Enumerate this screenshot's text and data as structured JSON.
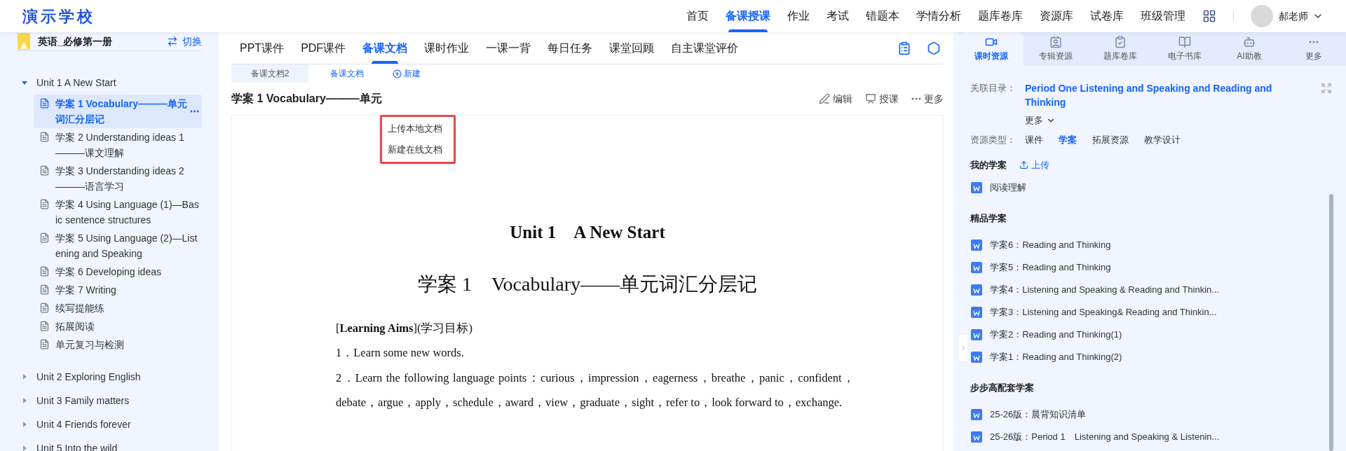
{
  "header": {
    "logo": "演示学校",
    "nav": [
      {
        "label": "首页",
        "selected": false
      },
      {
        "label": "备课授课",
        "selected": true
      },
      {
        "label": "作业",
        "selected": false
      },
      {
        "label": "考试",
        "selected": false
      },
      {
        "label": "错题本",
        "selected": false
      },
      {
        "label": "学情分析",
        "selected": false
      },
      {
        "label": "题库卷库",
        "selected": false
      },
      {
        "label": "资源库",
        "selected": false
      },
      {
        "label": "试卷库",
        "selected": false
      },
      {
        "label": "班级管理",
        "selected": false
      }
    ],
    "user": "郝老师"
  },
  "sidebar": {
    "book": "英语_必修第一册",
    "switch": "切换",
    "units": [
      {
        "label": "Unit 1 A New Start",
        "expanded": true,
        "children": [
          {
            "label": "学案 1 Vocabulary———单元词汇分层记",
            "selected": true
          },
          {
            "label": "学案 2 Understanding ideas 1 ———课文理解",
            "selected": false
          },
          {
            "label": "学案 3 Understanding ideas 2 ———语言学习",
            "selected": false
          },
          {
            "label": "学案 4 Using Language (1)—Basic sentence structures",
            "selected": false
          },
          {
            "label": "学案 5 Using Language (2)—Listening and Speaking",
            "selected": false
          },
          {
            "label": "学案 6 Developing ideas",
            "selected": false
          },
          {
            "label": "学案 7 Writing",
            "selected": false
          },
          {
            "label": "续写提能练",
            "selected": false
          },
          {
            "label": "拓展阅读",
            "selected": false
          },
          {
            "label": "单元复习与检测",
            "selected": false
          }
        ]
      },
      {
        "label": "Unit 2 Exploring English",
        "expanded": false
      },
      {
        "label": "Unit 3 Family matters",
        "expanded": false
      },
      {
        "label": "Unit 4 Friends forever",
        "expanded": false
      },
      {
        "label": "Unit 5 Into the wild",
        "expanded": false
      }
    ]
  },
  "main": {
    "tabs": [
      {
        "label": "PPT课件",
        "selected": false
      },
      {
        "label": "PDF课件",
        "selected": false
      },
      {
        "label": "备课文档",
        "selected": true
      },
      {
        "label": "课时作业",
        "selected": false
      },
      {
        "label": "一课一背",
        "selected": false
      },
      {
        "label": "每日任务",
        "selected": false
      },
      {
        "label": "课堂回顾",
        "selected": false
      },
      {
        "label": "自主课堂评价",
        "selected": false
      }
    ],
    "doc_tabs": [
      {
        "label": "备课文档2",
        "selected": false
      },
      {
        "label": "备课文档",
        "selected": true
      }
    ],
    "new": "新建",
    "menu": [
      "上传本地文档",
      "新建在线文档"
    ],
    "title": "学案 1 Vocabulary———单元",
    "actions": [
      "编辑",
      "授课",
      "更多"
    ],
    "document": {
      "heading": "Unit 1　A New Start",
      "subheading": "学案 1　Vocabulary——单元词汇分层记",
      "paragraphs": [
        "[**Learning Aims**](学习目标)",
        "1．Learn some new words.",
        "2．Learn the following language points：curious，impression，eagerness，breathe，panic，confident，debate，argue，apply，schedule，award，view，graduate，sight，refer to，look forward to，exchange."
      ]
    }
  },
  "panel": {
    "tabs": [
      {
        "label": "课时资源",
        "selected": true
      },
      {
        "label": "专辑资源",
        "selected": false
      },
      {
        "label": "题库卷库",
        "selected": false
      },
      {
        "label": "电子书库",
        "selected": false
      },
      {
        "label": "AI助教",
        "selected": false
      },
      {
        "label": "更多",
        "selected": false
      }
    ],
    "catalog_label": "关联目录：",
    "catalog": "Period One Listening and Speaking and Reading and Thinking",
    "more": "更多",
    "type_label": "资源类型：",
    "types": [
      {
        "label": "课件",
        "selected": false
      },
      {
        "label": "学案",
        "selected": true
      },
      {
        "label": "拓展资源",
        "selected": false
      },
      {
        "label": "教学设计",
        "selected": false
      }
    ],
    "sections": [
      {
        "title": "我的学案",
        "upload": "上传",
        "items": [
          "阅读理解"
        ]
      },
      {
        "title": "精品学案",
        "items": [
          "学案6：Reading and Thinking",
          "学案5：Reading and Thinking",
          "学案4：Listening and Speaking & Reading and Thinkin...",
          "学案3：Listening and Speaking& Reading and Thinkin...",
          "学案2：Reading and Thinking(1)",
          "学案1：Reading and Thinking(2)"
        ]
      },
      {
        "title": "步步高配套学案",
        "items": [
          "25-26版：晨背知识清单",
          "25-26版：Period 1　Listening and Speaking & Listenin..."
        ]
      }
    ]
  }
}
